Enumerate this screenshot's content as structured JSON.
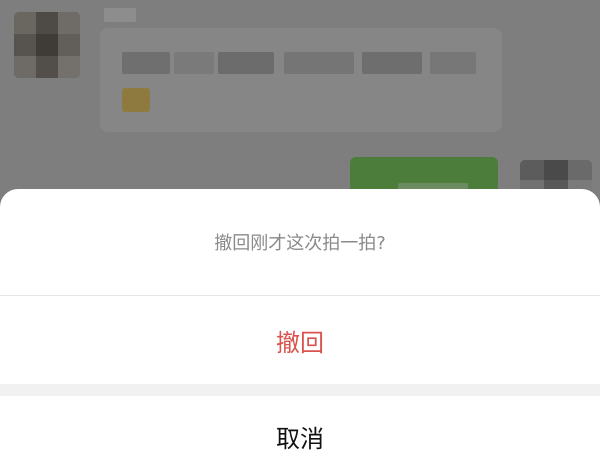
{
  "sheet": {
    "prompt": "撤回刚才这次拍一拍?",
    "confirm_label": "撤回",
    "cancel_label": "取消"
  },
  "colors": {
    "overlay": "#7f7f7f",
    "sheet_bg": "#ffffff",
    "confirm_text": "#d9534f",
    "prompt_text": "#8a8a8a",
    "cancel_text": "#111111",
    "own_bubble": "#4c7d3a"
  }
}
